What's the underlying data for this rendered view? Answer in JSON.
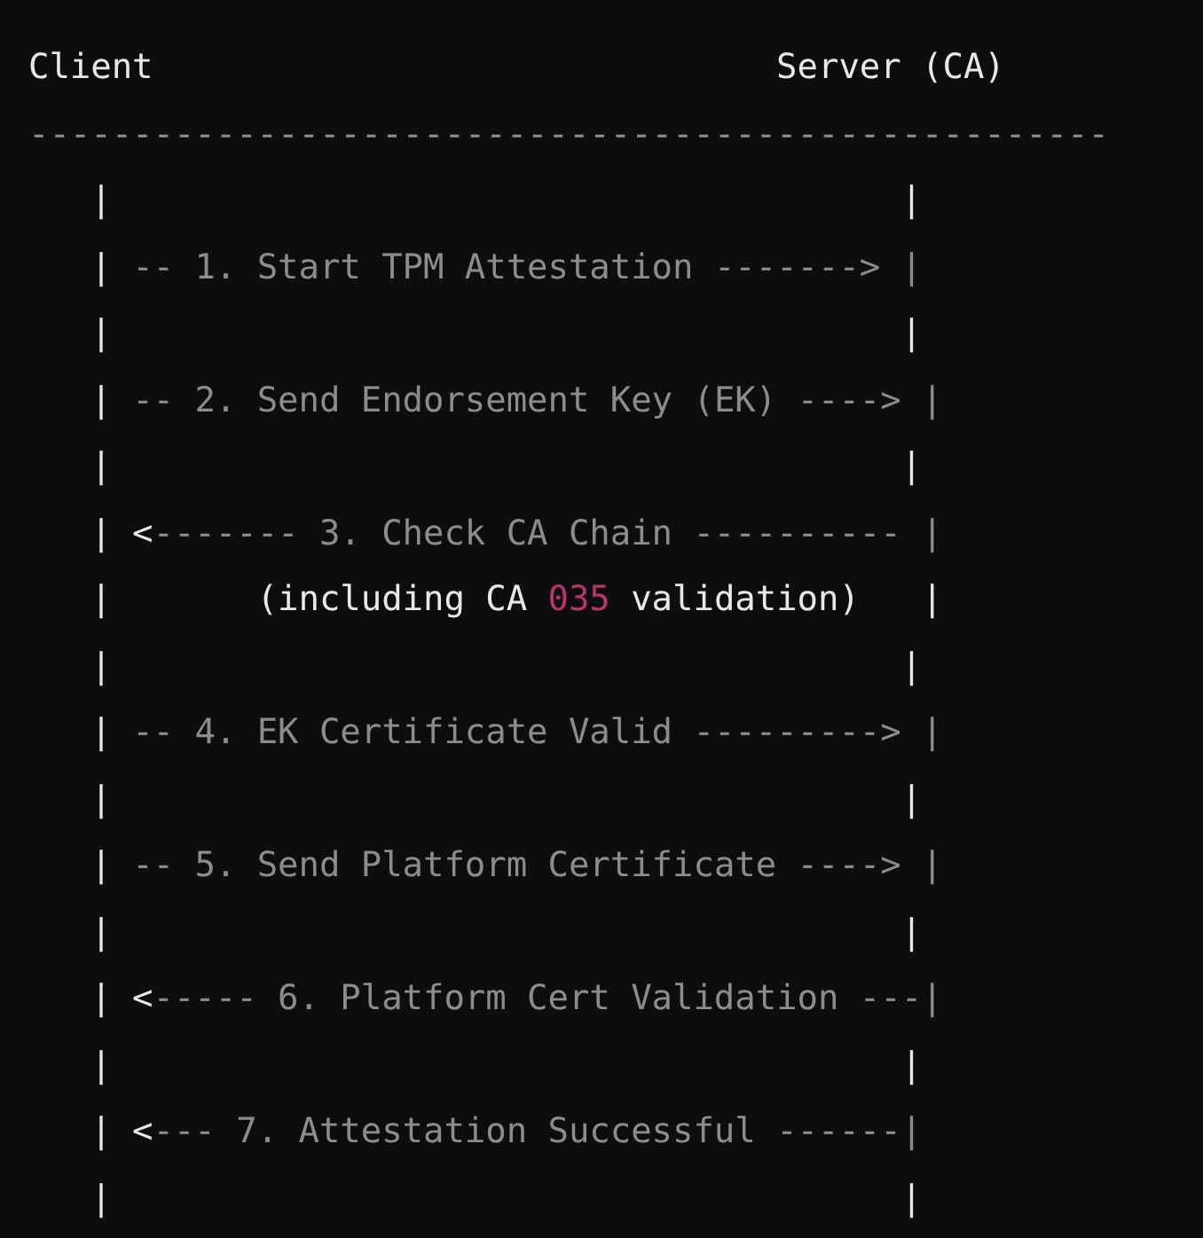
{
  "code_block": {
    "lines": [
      [
        {
          "kind": "bright",
          "text": "Client                              Server (CA)"
        }
      ],
      [
        {
          "kind": "dim",
          "text": "----------------------------------------------------"
        }
      ],
      [
        {
          "kind": "bright",
          "text": "   |                                      |"
        }
      ],
      [
        {
          "kind": "bright",
          "text": "   | "
        },
        {
          "kind": "dim",
          "text": "-- 1. Start TPM Attestation -------> |"
        }
      ],
      [
        {
          "kind": "bright",
          "text": "   |                                      |"
        }
      ],
      [
        {
          "kind": "bright",
          "text": "   | "
        },
        {
          "kind": "dim",
          "text": "-- 2. Send Endorsement Key (EK) ----> |"
        }
      ],
      [
        {
          "kind": "bright",
          "text": "   |                                      |"
        }
      ],
      [
        {
          "kind": "bright",
          "text": "   | <"
        },
        {
          "kind": "dim",
          "text": "------- 3. Check CA Chain ---------- |"
        }
      ],
      [
        {
          "kind": "bright",
          "text": "   |       (including CA "
        },
        {
          "kind": "number",
          "text": "035"
        },
        {
          "kind": "bright",
          "text": " validation)   |"
        }
      ],
      [
        {
          "kind": "bright",
          "text": "   |                                      |"
        }
      ],
      [
        {
          "kind": "bright",
          "text": "   | "
        },
        {
          "kind": "dim",
          "text": "-- 4. EK Certificate Valid ---------> |"
        }
      ],
      [
        {
          "kind": "bright",
          "text": "   |                                      |"
        }
      ],
      [
        {
          "kind": "bright",
          "text": "   | "
        },
        {
          "kind": "dim",
          "text": "-- 5. Send Platform Certificate ----> |"
        }
      ],
      [
        {
          "kind": "bright",
          "text": "   |                                      |"
        }
      ],
      [
        {
          "kind": "bright",
          "text": "   | <"
        },
        {
          "kind": "dim",
          "text": "----- 6. Platform Cert Validation ---|"
        }
      ],
      [
        {
          "kind": "bright",
          "text": "   |                                      |"
        }
      ],
      [
        {
          "kind": "bright",
          "text": "   | <"
        },
        {
          "kind": "dim",
          "text": "--- 7. Attestation Successful ------|"
        }
      ],
      [
        {
          "kind": "bright",
          "text": "   |                                      |"
        }
      ]
    ]
  }
}
